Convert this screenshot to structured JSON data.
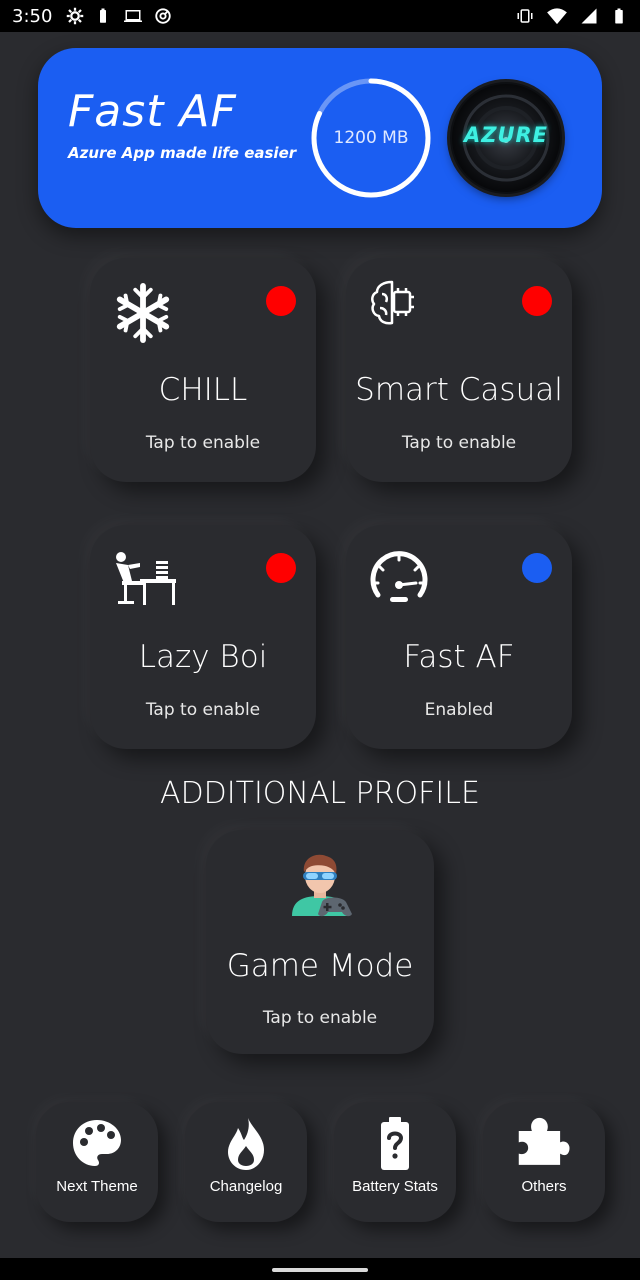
{
  "status_bar": {
    "time": "3:50",
    "left_icons": [
      "settings-gear-icon",
      "battery-small-icon",
      "laptop-icon",
      "at-sign-icon"
    ],
    "right_icons": [
      "vibrate-icon",
      "wifi-icon",
      "signal-icon",
      "battery-icon"
    ]
  },
  "header": {
    "title": "Fast AF",
    "subtitle": "Azure App made life easier",
    "ram_value": "1200 MB",
    "ram_ring_fraction": 0.82,
    "logo_text": "AZURE",
    "accent_color": "#1b5ef2"
  },
  "profiles": [
    {
      "name": "CHILL",
      "status": "Tap to enable",
      "icon": "snowflake-icon",
      "state_color": "#ff0000"
    },
    {
      "name": "Smart Casual",
      "status": "Tap to enable",
      "icon": "brain-chip-icon",
      "state_color": "#ff0000"
    },
    {
      "name": "Lazy Boi",
      "status": "Tap to enable",
      "icon": "relaxing-person-icon",
      "state_color": "#ff0000"
    },
    {
      "name": "Fast AF",
      "status": "Enabled",
      "icon": "speedometer-icon",
      "state_color": "#1b5ef2"
    }
  ],
  "additional": {
    "section_title": "ADDITIONAL PROFILE",
    "game_mode": {
      "name": "Game Mode",
      "status": "Tap to enable",
      "icon": "gamer-icon"
    }
  },
  "bottom_buttons": [
    {
      "label": "Next Theme",
      "icon": "palette-icon"
    },
    {
      "label": "Changelog",
      "icon": "flame-icon"
    },
    {
      "label": "Battery Stats",
      "icon": "battery-question-icon"
    },
    {
      "label": "Others",
      "icon": "puzzle-icon"
    }
  ]
}
